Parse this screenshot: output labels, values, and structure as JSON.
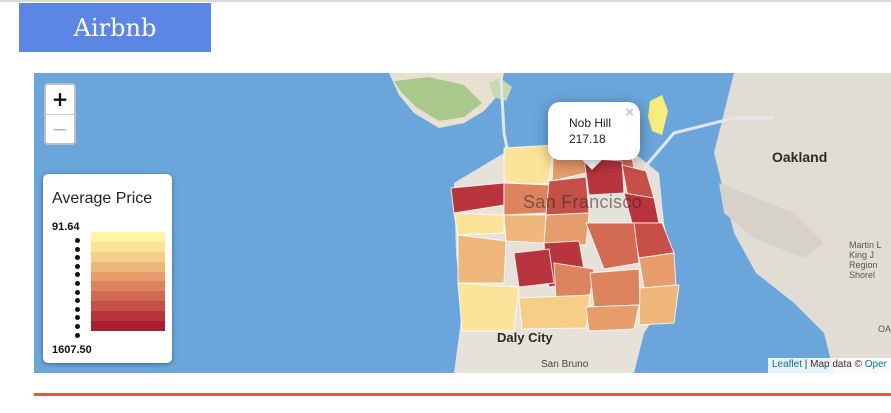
{
  "header": {
    "brand": "Airbnb"
  },
  "map": {
    "zoom": {
      "in_label": "+",
      "out_label": "−"
    },
    "labels": {
      "city": "San Francisco",
      "oakland": "Oakland",
      "daly_city": "Daly City",
      "san_bruno": "San Bruno",
      "martin": "Martin L King J Region Shorel",
      "oa": "OA"
    },
    "popup": {
      "name": "Nob Hill",
      "value": "217.18",
      "close": "×"
    },
    "attribution": {
      "leaflet": "Leaflet",
      "separator": " | Map data © ",
      "provider": "Oper"
    }
  },
  "legend": {
    "title": "Average Price",
    "max": "91.64",
    "min": "1607.50",
    "colors": [
      "#fff5a5",
      "#fbe499",
      "#f5cf87",
      "#eeb779",
      "#e69d6b",
      "#dd845e",
      "#d26a52",
      "#c64f48",
      "#b9353d",
      "#ab1b31"
    ]
  },
  "colors": {
    "brand": "#5b86e5",
    "water": "#6aa6db",
    "accent_bar": "#e05a4a"
  }
}
